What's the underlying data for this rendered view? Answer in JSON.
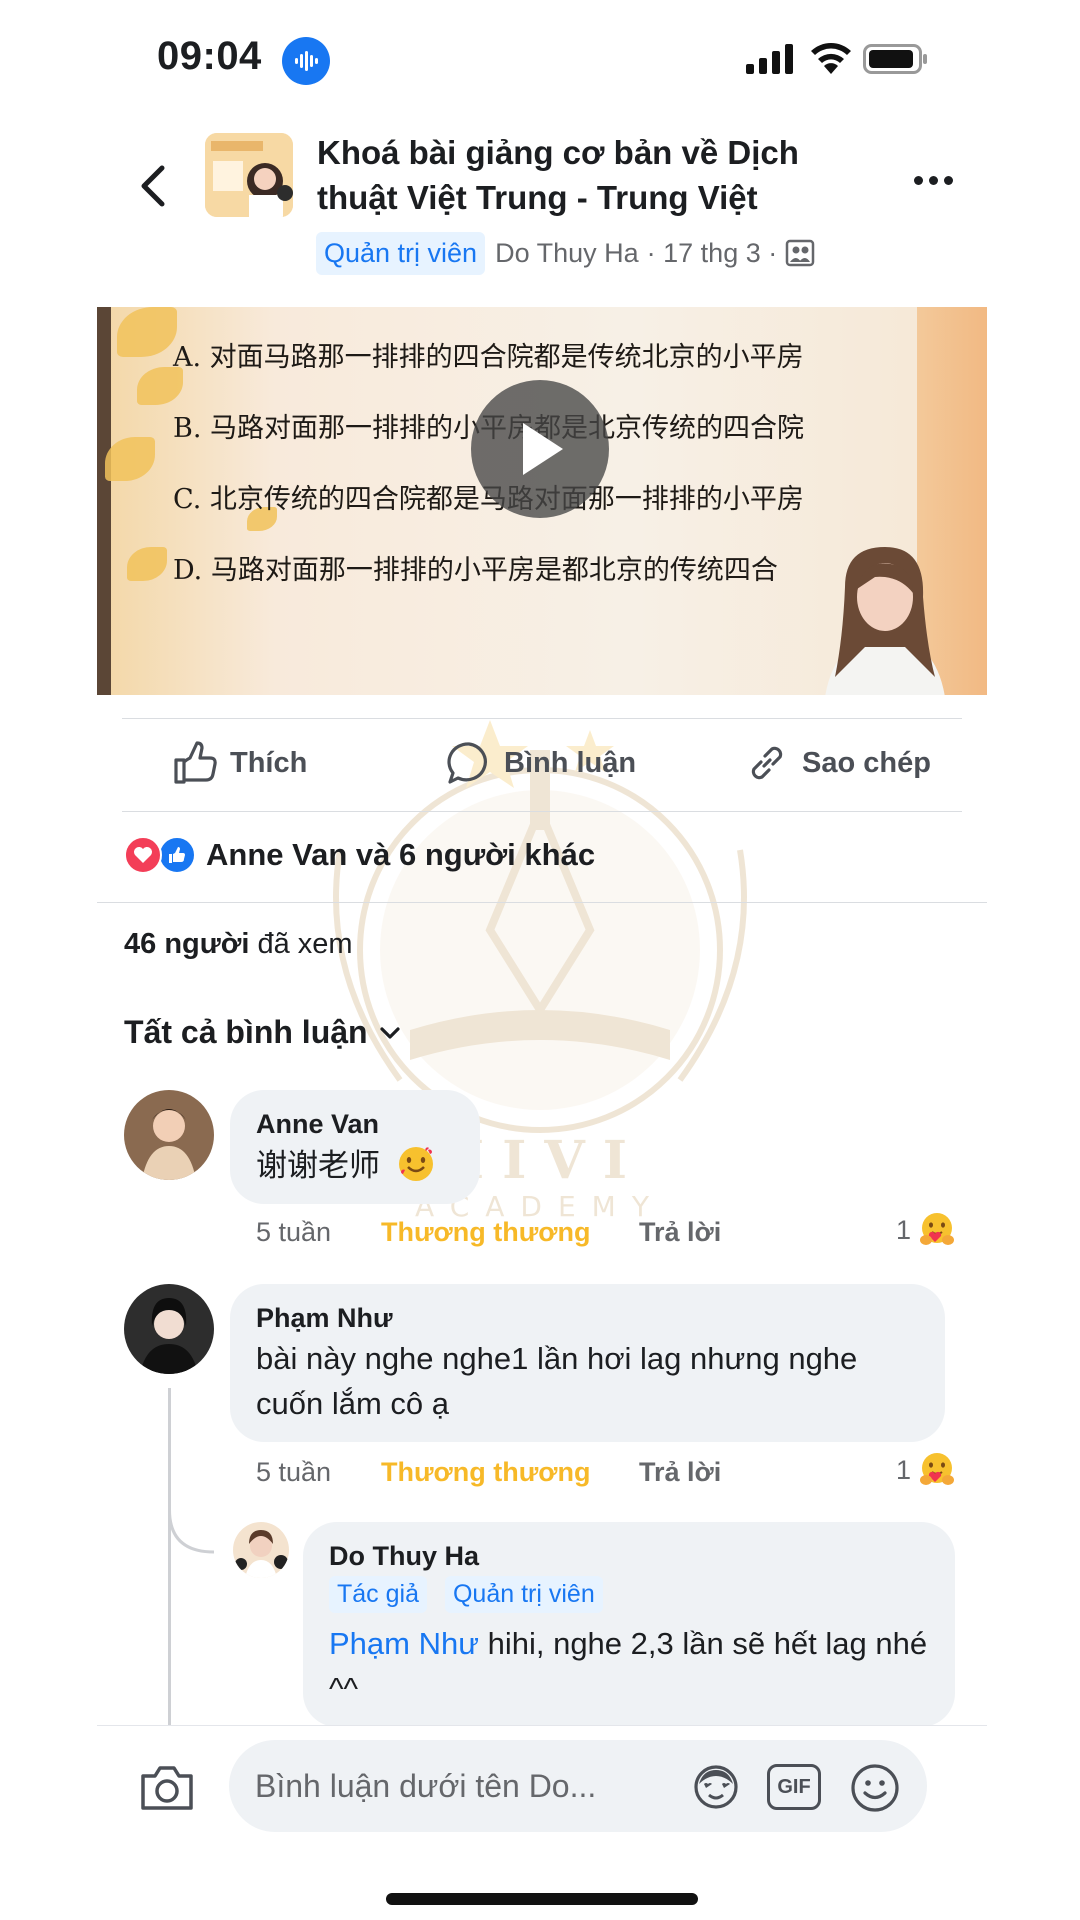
{
  "status_bar": {
    "time": "09:04"
  },
  "header": {
    "title": "Khoá bài giảng cơ bản về Dịch thuật Việt Trung - Trung Việt",
    "role_badge": "Quản trị viên",
    "author": "Do Thuy Ha",
    "date": "· 17 thg 3 ·"
  },
  "video": {
    "lines": [
      "A. 对面马路那一排排的四合院都是传统北京的小平房",
      "B.  马路对面那一排排的小平房都是北京传统的四合院",
      "C.  北京传统的四合院都是马路对面那一排排的小平房",
      "D.  马路对面那一排排的小平房是都北京的传统四合"
    ]
  },
  "actions": {
    "like": "Thích",
    "comment": "Bình luận",
    "copy": "Sao chép"
  },
  "reactions": {
    "summary": "Anne Van và 6 người khác"
  },
  "views": {
    "count": "46 người",
    "rest": " đã xem"
  },
  "comments_filter": "Tất cả bình luận",
  "watermark": {
    "brand": "HIVI",
    "sub": "ACADEMY"
  },
  "comments": [
    {
      "name": "Anne Van",
      "text": "谢谢老师",
      "time": "5 tuần",
      "reaction_label": "Thương thương",
      "reply_label": "Trả lời",
      "count": "1"
    },
    {
      "name": "Phạm Như",
      "text": "bài này nghe nghe1 lần hơi lag nhưng nghe cuốn lắm cô ạ",
      "time": "5 tuần",
      "reaction_label": "Thương thương",
      "reply_label": "Trả lời",
      "count": "1"
    },
    {
      "name": "Do Thuy Ha",
      "tags": [
        "Tác giả",
        "Quản trị viên"
      ],
      "mention": "Phạm Như",
      "text": " hihi, nghe 2,3 lần sẽ hết lag nhé ^^"
    }
  ],
  "composer": {
    "placeholder": "Bình luận dưới tên Do..."
  }
}
